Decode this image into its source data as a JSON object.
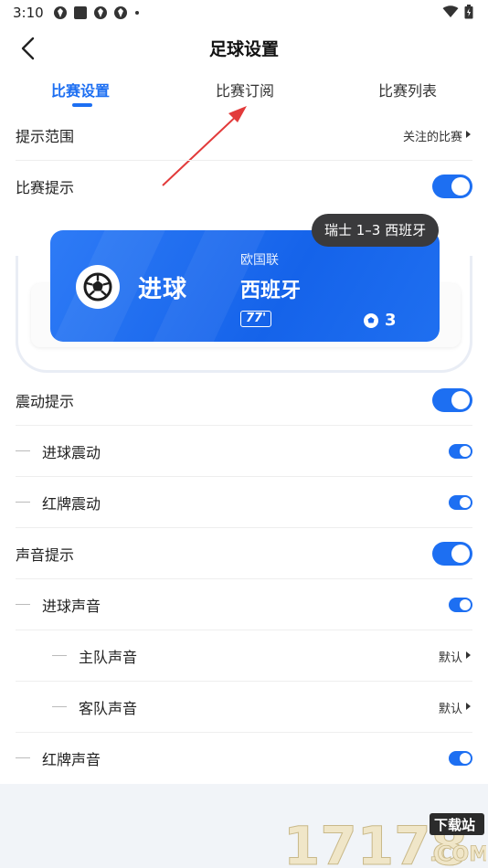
{
  "status_bar": {
    "time": "3:10",
    "left_icons": [
      "game-icon",
      "square-icon",
      "game-icon",
      "game-icon"
    ],
    "right_icons": [
      "wifi-icon",
      "battery-icon"
    ]
  },
  "header": {
    "title": "足球设置"
  },
  "tabs": [
    {
      "label": "比赛设置",
      "active": true
    },
    {
      "label": "比赛订阅",
      "active": false
    },
    {
      "label": "比赛列表",
      "active": false
    }
  ],
  "settings": {
    "range": {
      "label": "提示范围",
      "value": "关注的比赛"
    },
    "match_alert": {
      "label": "比赛提示",
      "on": true
    },
    "vibration": {
      "label": "震动提示",
      "on": true
    },
    "goal_vibration": {
      "label": "进球震动",
      "on": true
    },
    "red_card_vibration": {
      "label": "红牌震动",
      "on": true
    },
    "sound": {
      "label": "声音提示",
      "on": true
    },
    "goal_sound": {
      "label": "进球声音",
      "on": true
    },
    "home_sound": {
      "label": "主队声音",
      "value": "默认"
    },
    "away_sound": {
      "label": "客队声音",
      "value": "默认"
    },
    "red_card_sound": {
      "label": "红牌声音",
      "on": true
    }
  },
  "preview": {
    "goal_label": "进球",
    "league": "欧国联",
    "team": "西班牙",
    "minute": "77'",
    "goal_count": "3",
    "score_pill": "瑞士 1–3 西班牙"
  },
  "colors": {
    "accent": "#1d6ff2",
    "pill": "#3a3a3c",
    "arrow": "#e23a3a"
  },
  "watermark": {
    "main": "17178",
    "tag": "下载站",
    "domain": ".COM"
  }
}
